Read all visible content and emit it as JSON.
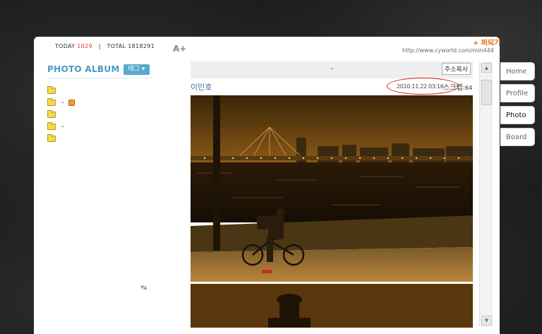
{
  "header": {
    "today_label": "TODAY",
    "today_count": "1029",
    "total_label": "TOTAL",
    "total_count": "1818291",
    "font_size_button": "A+",
    "bookmark_label": "+ 퍼되기",
    "url": "http://www.cyworld.com/min444"
  },
  "sidebar": {
    "title": "PHOTO ALBUM",
    "tag_button": "태그 ▾",
    "folders": [
      {
        "label": ""
      },
      {
        "label": "-",
        "has_badge": true
      },
      {
        "label": ""
      },
      {
        "label": "-"
      },
      {
        "label": ""
      }
    ],
    "collapse_label": "▼▲"
  },
  "post": {
    "title": "-",
    "copy_address_button": "주소복사",
    "author": "이민호",
    "timestamp": "2010.11.22 03:16",
    "scrap_label": "스크랩",
    "scrap_count": "64"
  },
  "tabs": [
    {
      "label": "Home"
    },
    {
      "label": "Profile"
    },
    {
      "label": "Photo",
      "active": true
    },
    {
      "label": "Board"
    }
  ],
  "colors": {
    "accent_blue": "#4a9ac0",
    "count_red": "#e03a2a",
    "bookmark_orange": "#e06a1a",
    "highlight_red": "#d02020"
  }
}
